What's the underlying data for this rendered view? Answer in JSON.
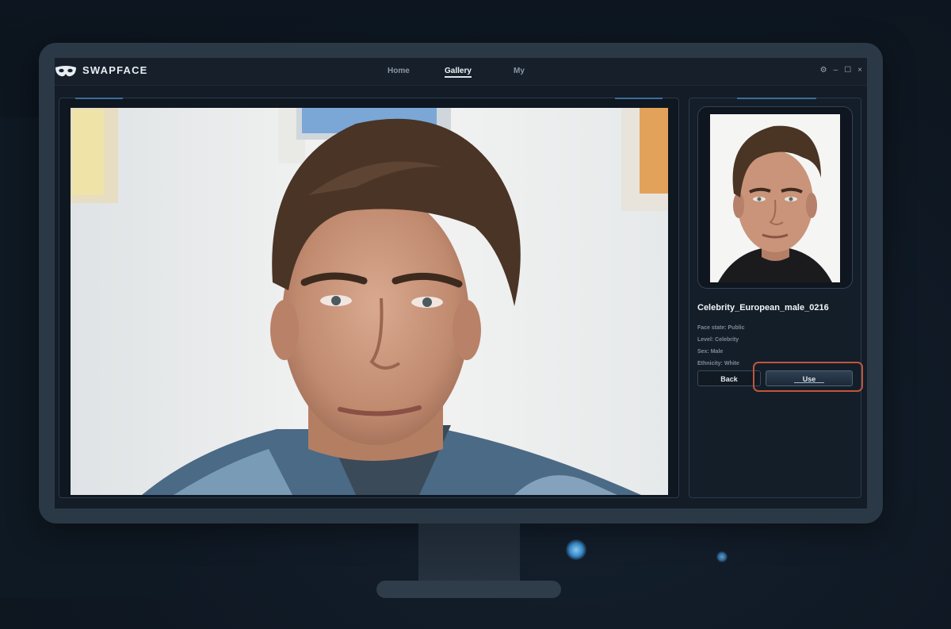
{
  "app": {
    "brand": "SWAPFACE",
    "logo_icon": "mask-icon"
  },
  "nav": {
    "items": [
      {
        "label": "Home"
      },
      {
        "label": "Gallery",
        "active": true
      },
      {
        "label": "My"
      }
    ]
  },
  "window_controls": {
    "settings": "⚙",
    "minimize": "–",
    "maximize": "☐",
    "close": "×"
  },
  "face_card": {
    "name": "Celebrity_European_male_0216",
    "details": [
      "Face state: Public",
      "Level: Celebrity",
      "Sex: Male",
      "Ethnicity: White"
    ]
  },
  "buttons": {
    "back": "Back",
    "use": "Use"
  },
  "colors": {
    "accent": "#3b6d9a",
    "highlight": "#c0553e",
    "panel_bg": "#141e29"
  }
}
